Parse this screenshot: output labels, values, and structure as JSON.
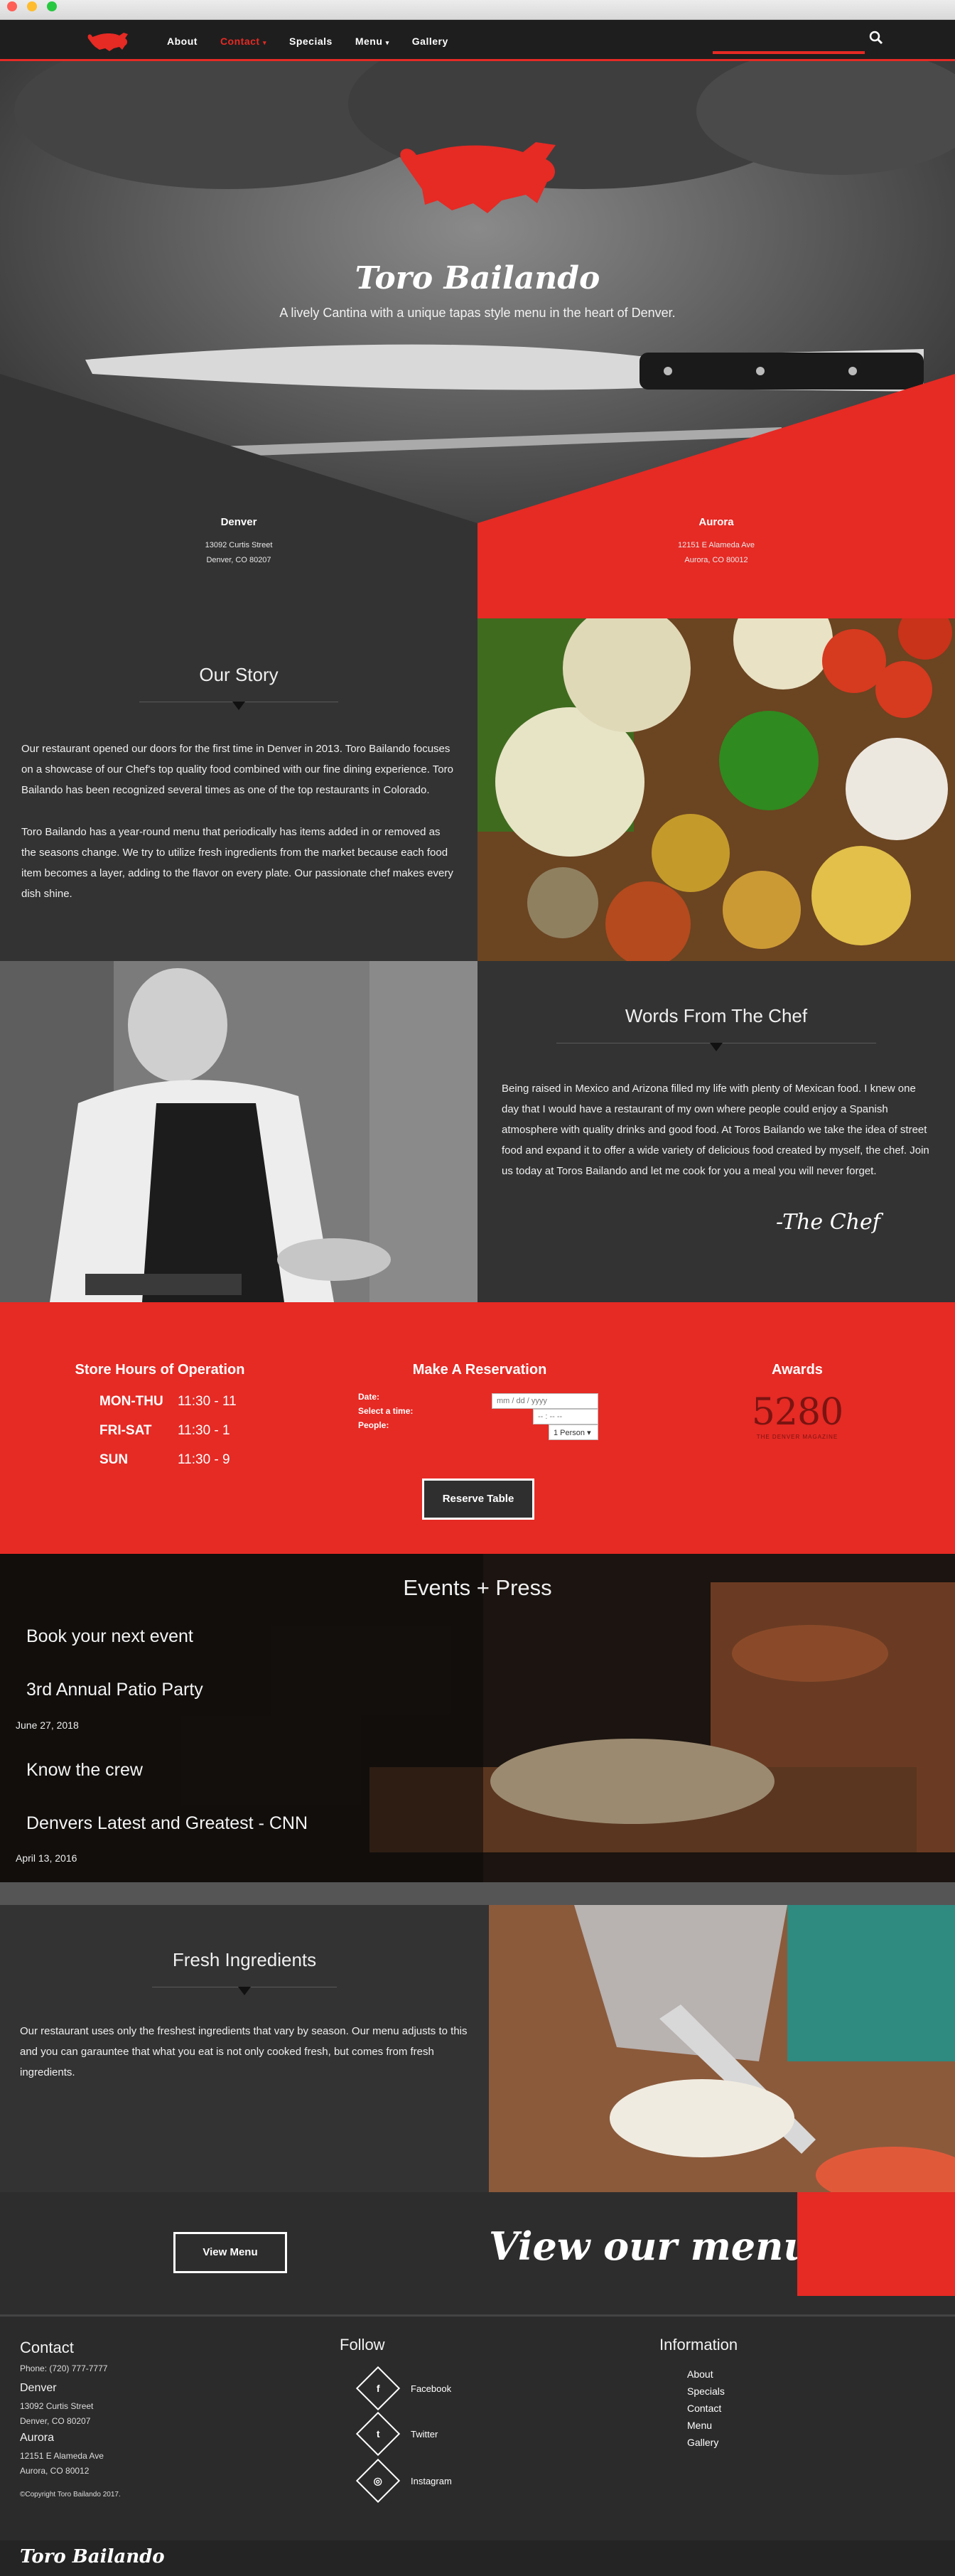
{
  "nav": {
    "items": [
      "About",
      "Contact",
      "Specials",
      "Menu",
      "Gallery"
    ],
    "active_item": "Contact",
    "dropdown_items": [
      "Contact",
      "Menu"
    ]
  },
  "hero": {
    "brand": "Toro Bailando",
    "tagline": "A lively Cantina with a unique tapas style menu in the heart of Denver."
  },
  "locations": [
    {
      "name": "Denver",
      "address1": "13092 Curtis Street",
      "address2": "Denver, CO 80207"
    },
    {
      "name": "Aurora",
      "address1": "12151 E Alameda Ave",
      "address2": "Aurora, CO 80012"
    }
  ],
  "story": {
    "title": "Our Story",
    "para1": "Our restaurant opened our doors for the first time in Denver in 2013. Toro Bailando focuses on a showcase of our Chef's top quality food combined with our fine dining experience. Toro Bailando has been recognized several times as one of the top restaurants in Colorado.",
    "para2": "Toro Bailando has a year-round menu that periodically has items added in or removed as the seasons change. We try to utilize fresh ingredients from the market because each food item becomes a layer, adding to the flavor on every plate. Our passionate chef makes every dish shine."
  },
  "chef": {
    "title": "Words From The Chef",
    "text": "Being raised in Mexico and Arizona filled my life with plenty of Mexican food. I knew one day that I would have a restaurant of my own where people could enjoy a Spanish atmosphere with quality drinks and good food. At Toros Bailando we take the idea of street food and expand it to offer a wide variety of delicious food created by myself, the chef. Join us today at Toros Bailando and let me cook for you a meal you will never forget.",
    "signature": "-The Chef"
  },
  "hours": {
    "title": "Store Hours of Operation",
    "rows": [
      {
        "days": "MON-THU",
        "time": "11:30 - 11"
      },
      {
        "days": "FRI-SAT",
        "time": "11:30 - 1"
      },
      {
        "days": "SUN",
        "time": "11:30 - 9"
      }
    ]
  },
  "reservation": {
    "title": "Make A Reservation",
    "date_label": "Date:",
    "time_label": "Select a time:",
    "people_label": "People:",
    "date_placeholder": "mm / dd / yyyy",
    "time_placeholder": "-- : -- --",
    "people_value": "1 Person",
    "button": "Reserve Table"
  },
  "awards": {
    "title": "Awards",
    "logo_text": "5280",
    "logo_sub": "THE DENVER MAGAZINE"
  },
  "events": {
    "title": "Events + Press",
    "items": [
      {
        "text": "Book your next event",
        "date": ""
      },
      {
        "text": "3rd Annual Patio Party",
        "date": "June 27, 2018"
      },
      {
        "text": "Know the crew",
        "date": ""
      },
      {
        "text": "Denvers Latest and Greatest - CNN",
        "date": "April 13, 2016"
      }
    ]
  },
  "fresh": {
    "title": "Fresh Ingredients",
    "text": "Our restaurant uses only the freshest ingredients that vary by season. Our menu adjusts to this and you can garauntee that what you eat is not only cooked fresh, but comes from fresh ingredients."
  },
  "view_menu": {
    "button": "View Menu",
    "script": "View our menu"
  },
  "footer": {
    "contact_title": "Contact",
    "phone": "Phone: (720) 777-7777",
    "locations": [
      {
        "name": "Denver",
        "address1": "13092 Curtis Street",
        "address2": "Denver, CO 80207"
      },
      {
        "name": "Aurora",
        "address1": "12151 E Alameda Ave",
        "address2": "Aurora, CO 80012"
      }
    ],
    "copyright": "©Copyright Toro Bailando 2017.",
    "follow_title": "Follow",
    "social": [
      {
        "label": "Facebook",
        "icon": "f"
      },
      {
        "label": "Twitter",
        "icon": "t"
      },
      {
        "label": "Instagram",
        "icon": "◎"
      }
    ],
    "info_title": "Information",
    "info_links": [
      "About",
      "Specials",
      "Contact",
      "Menu",
      "Gallery"
    ],
    "bottom_brand": "Toro Bailando"
  },
  "colors": {
    "accent": "#e62a24",
    "dark": "#333333",
    "darker": "#1e1e1e"
  }
}
